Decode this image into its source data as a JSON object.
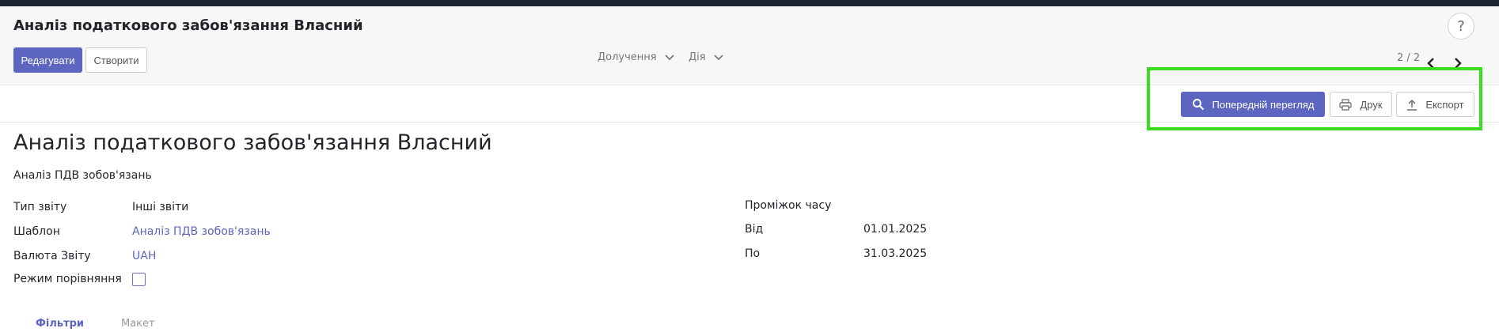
{
  "breadcrumb": "Аналіз податкового забов'язання Власний",
  "toolbar": {
    "edit_label": "Редагувати",
    "create_label": "Створити",
    "attachments_label": "Долучення",
    "action_label": "Дія",
    "pager": "2 / 2",
    "help": "?"
  },
  "report_actions": {
    "preview_label": "Попередній перегляд",
    "print_label": "Друк",
    "export_label": "Експорт"
  },
  "form": {
    "title": "Аналіз податкового забов'язання Власний",
    "subtitle": "Аналіз ПДВ зобов'язань",
    "left_fields": [
      {
        "label": "Тип звіту",
        "value": "Інші звіти"
      },
      {
        "label": "Шаблон",
        "value": "Аналіз ПДВ зобов'язань"
      },
      {
        "label": "Валюта Звіту",
        "value": "UAH"
      },
      {
        "label": "Режим порівняння",
        "value": ""
      }
    ],
    "period_label": "Проміжок часу",
    "right_fields": [
      {
        "label": "Від",
        "value": "01.01.2025"
      },
      {
        "label": "По",
        "value": "31.03.2025"
      }
    ],
    "comparison_mode_checked": false
  },
  "tabs": [
    "Фільтри",
    "Макет"
  ],
  "colors": {
    "accent": "#5c65bf",
    "highlight": "#3bdc1f",
    "topbar": "#1f2433"
  },
  "icons": [
    "chevron-right-icon",
    "chevron-down-icon",
    "chevron-left-icon",
    "search-icon",
    "printer-icon",
    "upload-icon",
    "help-icon"
  ]
}
